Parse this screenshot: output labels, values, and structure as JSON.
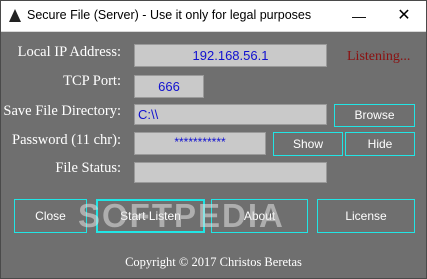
{
  "window": {
    "title": "Secure File (Server) - Use it only for legal purposes",
    "minimize_glyph": "—",
    "close_glyph": "✕"
  },
  "form": {
    "ip_label": "Local IP Address:",
    "ip_value": "192.168.56.1",
    "status_text": "Listening...",
    "port_label": "TCP Port:",
    "port_value": "666",
    "dir_label": "Save File Directory:",
    "dir_value": "C:\\\\",
    "browse_label": "Browse",
    "password_label": "Password (11 chr):",
    "password_value": "***********",
    "show_label": "Show",
    "hide_label": "Hide",
    "file_status_label": "File Status:",
    "file_status_value": ""
  },
  "actions": {
    "close_label": "Close",
    "start_label": "Start Listen",
    "about_label": "About",
    "license_label": "License"
  },
  "watermark": "SOFTPEDIA",
  "footer": {
    "copyright": "Copyright © 2017 Christos Beretas"
  },
  "colors": {
    "accent": "#21e5e5",
    "background": "#6f6f6f",
    "status": "#8b1010",
    "field_text": "#1010d0"
  }
}
